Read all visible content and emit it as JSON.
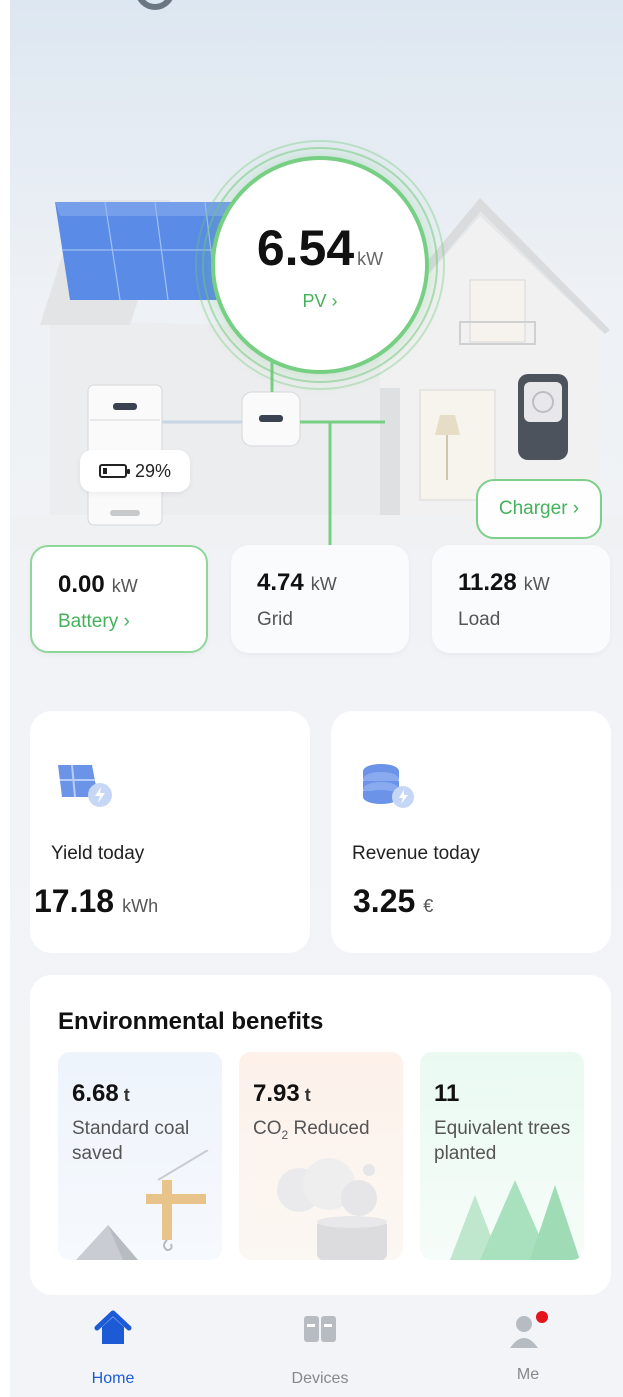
{
  "pv": {
    "value": "6.54",
    "unit": "kW",
    "link": "PV ›"
  },
  "battery_badge": {
    "percent": "29%"
  },
  "charger": {
    "label": "Charger ›"
  },
  "flows": {
    "battery": {
      "value": "0.00",
      "unit": "kW",
      "label": "Battery ›"
    },
    "grid": {
      "value": "4.74",
      "unit": "kW",
      "label": "Grid"
    },
    "load": {
      "value": "11.28",
      "unit": "kW",
      "label": "Load"
    }
  },
  "stats": {
    "yield": {
      "label": "Yield today",
      "value": "17.18",
      "unit": "kWh",
      "icon": "solar-panel-icon"
    },
    "revenue": {
      "label": "Revenue today",
      "value": "3.25",
      "unit": "€",
      "icon": "coin-stack-icon"
    }
  },
  "environment": {
    "title": "Environmental benefits",
    "coal": {
      "value": "6.68",
      "unit": "t",
      "label": "Standard coal saved"
    },
    "co2": {
      "value": "7.93",
      "unit": "t",
      "label_prefix": "CO",
      "label_sub": "2",
      "label_suffix": " Reduced"
    },
    "trees": {
      "value": "11",
      "label": "Equivalent trees planted"
    }
  },
  "nav": {
    "home": "Home",
    "devices": "Devices",
    "me": "Me"
  },
  "colors": {
    "accent_green": "#44b25a",
    "nav_active": "#1d5bd6",
    "notification_dot": "#e3141b"
  }
}
